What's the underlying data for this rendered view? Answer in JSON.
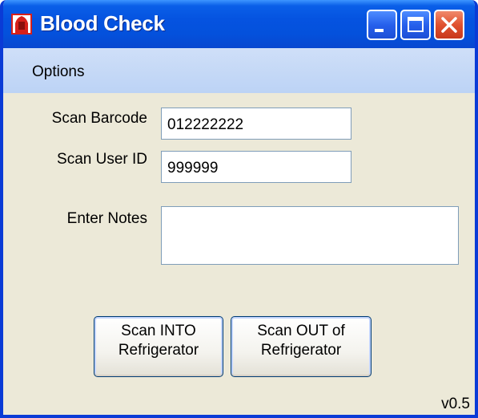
{
  "window": {
    "title": "Blood Check",
    "icon": "blood-drop-app-icon",
    "controls": [
      "minimize-icon",
      "maximize-icon",
      "close-icon"
    ]
  },
  "menu": {
    "items": [
      {
        "label": "Options"
      }
    ]
  },
  "form": {
    "barcode": {
      "label": "Scan Barcode",
      "value": "012222222"
    },
    "user_id": {
      "label": "Scan User ID",
      "value": "999999"
    },
    "notes": {
      "label": "Enter Notes",
      "value": ""
    }
  },
  "buttons": {
    "scan_into": {
      "line1": "Scan INTO",
      "line2": "Refrigerator"
    },
    "scan_out": {
      "line1": "Scan OUT of",
      "line2": "Refrigerator"
    }
  },
  "status": {
    "version": "v0.5"
  },
  "colors": {
    "titlebar": "#0553e0",
    "menubar": "#bcd3f5",
    "client_bg": "#ece9d8",
    "close_button": "#e0512f",
    "icon_red": "#d8201a"
  }
}
